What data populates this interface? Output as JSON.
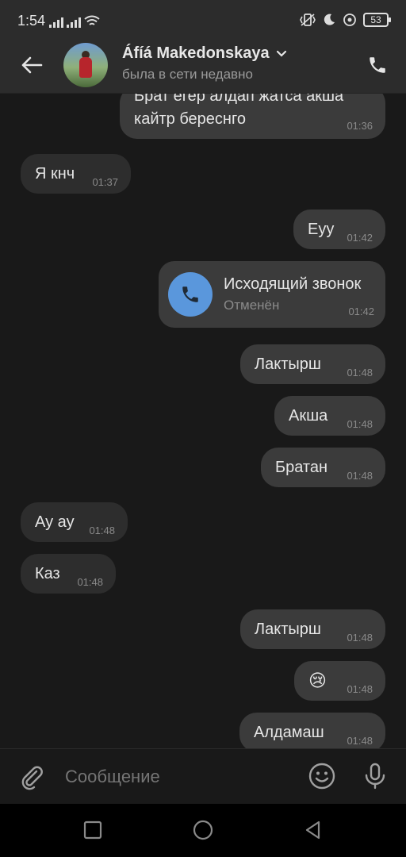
{
  "status_bar": {
    "time": "1:54",
    "battery": "53"
  },
  "header": {
    "contact_name": "Áfíá Makedonskaya",
    "contact_status": "была в сети недавно"
  },
  "messages": [
    {
      "dir": "out",
      "text_line1": "Брат егер алдап жатса акша",
      "text_line2": "кайтр береснго",
      "time": "01:36"
    },
    {
      "dir": "in",
      "text": "Я кнч",
      "time": "01:37"
    },
    {
      "dir": "out",
      "text": "Еуу",
      "time": "01:42"
    },
    {
      "dir": "out",
      "type": "call",
      "title": "Исходящий звонок",
      "subtitle": "Отменён",
      "time": "01:42"
    },
    {
      "dir": "out",
      "text": "Лактырш",
      "time": "01:48"
    },
    {
      "dir": "out",
      "text": "Акша",
      "time": "01:48"
    },
    {
      "dir": "out",
      "text": "Братан",
      "time": "01:48"
    },
    {
      "dir": "in",
      "text": "Ау ау",
      "time": "01:48"
    },
    {
      "dir": "in",
      "text": "Каз",
      "time": "01:48"
    },
    {
      "dir": "out",
      "text": "Лактырш",
      "time": "01:48"
    },
    {
      "dir": "out",
      "text": "😢",
      "time": "01:48"
    },
    {
      "dir": "out",
      "text": "Алдамаш",
      "time": "01:48"
    }
  ],
  "composer": {
    "placeholder": "Сообщение"
  },
  "icons": {
    "back": "arrow-left-icon",
    "dropdown": "chevron-down-icon",
    "call": "phone-icon",
    "attach": "paperclip-icon",
    "emoji": "smiley-icon",
    "mic": "microphone-icon"
  },
  "colors": {
    "accent": "#5a97dc",
    "bubble_out": "#3b3b3b",
    "bubble_in": "#2d2d2d",
    "background": "#191919"
  }
}
